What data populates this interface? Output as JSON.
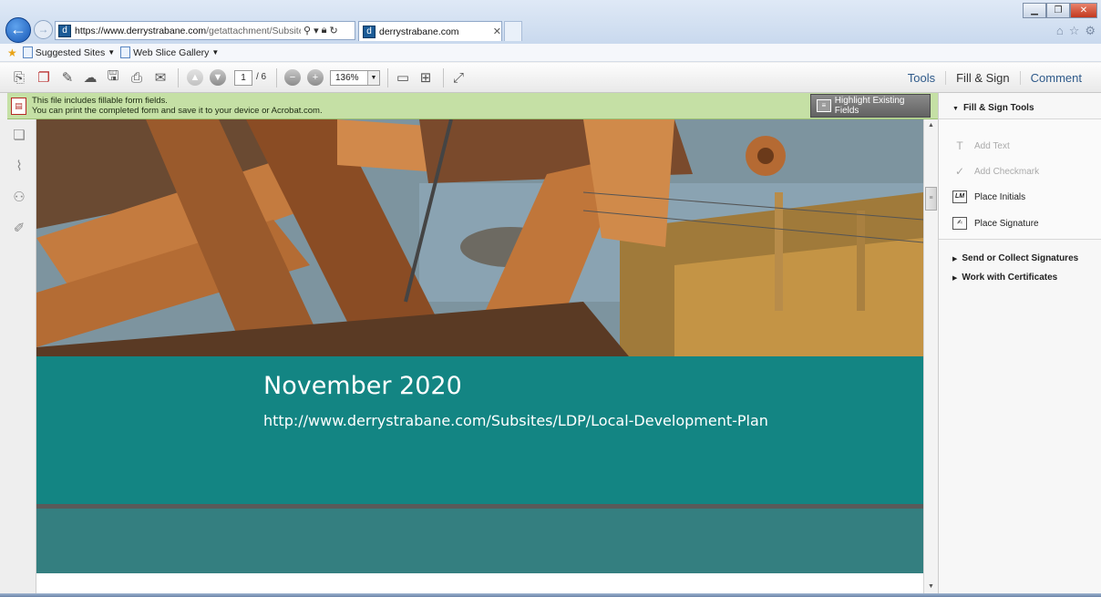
{
  "browser": {
    "url_main": "https://www.derrystrabane.com",
    "url_rest": "/getattachment/Subsites/LDF",
    "tab_title": "derrystrabane.com",
    "favorites": [
      {
        "label": "Suggested Sites"
      },
      {
        "label": "Web Slice Gallery"
      }
    ]
  },
  "toolbar": {
    "page_current": "1",
    "page_total": "/ 6",
    "zoom": "136%",
    "right_tabs": [
      "Tools",
      "Fill & Sign",
      "Comment"
    ]
  },
  "notice": {
    "line1": "This file includes fillable form fields.",
    "line2": "You can print the completed form and save it to your device or Acrobat.com.",
    "button": "Highlight Existing Fields"
  },
  "document": {
    "title": "November 2020",
    "url": "http://www.derrystrabane.com/Subsites/LDP/Local-Development-Plan"
  },
  "pane": {
    "section_title": "Fill & Sign Tools",
    "items": [
      {
        "label": "Add Text",
        "enabled": false,
        "icon": "text-t-icon"
      },
      {
        "label": "Add Checkmark",
        "enabled": false,
        "icon": "checkmark-icon"
      },
      {
        "label": "Place Initials",
        "enabled": true,
        "icon": "initials-icon"
      },
      {
        "label": "Place Signature",
        "enabled": true,
        "icon": "signature-icon"
      }
    ],
    "collapsed": [
      "Send or Collect Signatures",
      "Work with Certificates"
    ]
  },
  "colors": {
    "teal": "#138583",
    "teal_dark": "#347f80",
    "notice_green": "#c5e0a5",
    "link_blue": "#2f5a8a"
  }
}
